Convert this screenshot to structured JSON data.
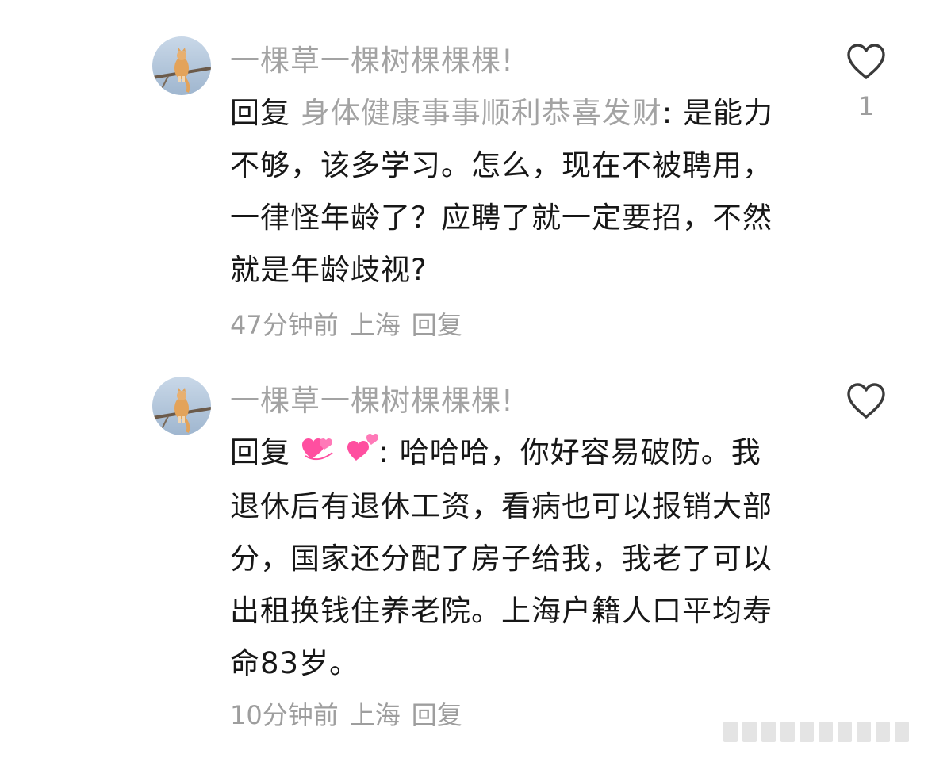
{
  "comments": [
    {
      "username": "一棵草一棵树棵棵棵!",
      "reply_prefix": "回复",
      "reply_target": "身体健康事事顺利恭喜发财",
      "reply_separator": ": ",
      "body": "是能力不够，该多学习。怎么，现在不被聘用，一律怪年龄了？应聘了就一定要招，不然就是年龄歧视?",
      "time": "47分钟前",
      "location": "上海",
      "reply_label": "回复",
      "like_count": "1",
      "like_icon": "heart-outline-icon",
      "avatar_icon": "cat-on-branch-avatar"
    },
    {
      "username": "一棵草一棵树棵棵棵!",
      "reply_prefix": "回复",
      "reply_target_emoji": [
        "revolving-hearts-emoji",
        "two-hearts-emoji"
      ],
      "reply_separator": ": ",
      "body": "哈哈哈，你好容易破防。我退休后有退休工资，看病也可以报销大部分，国家还分配了房子给我，我老了可以出租换钱住养老院。上海户籍人口平均寿命83岁。",
      "time": "10分钟前",
      "location": "上海",
      "reply_label": "回复",
      "like_count": "",
      "like_icon": "heart-outline-icon",
      "avatar_icon": "cat-on-branch-avatar"
    }
  ],
  "colors": {
    "text": "#171717",
    "muted": "#a3a3a3",
    "heart_emoji": "#ff4fa0"
  }
}
